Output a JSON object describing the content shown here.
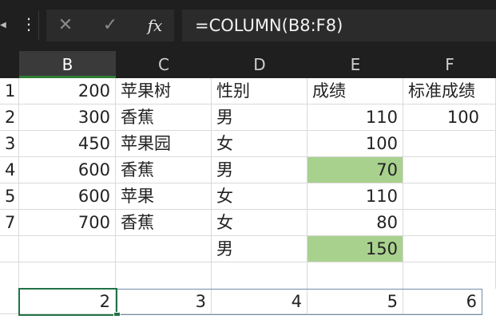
{
  "formula_bar": {
    "left_arrow": "◀",
    "menu_icon": "⋮",
    "cancel_icon": "✕",
    "confirm_icon": "✓",
    "fx_label": "fx",
    "formula": "=COLUMN(B8:F8)"
  },
  "columns": [
    "B",
    "C",
    "D",
    "E",
    "F"
  ],
  "rows": [
    {
      "rownum": "1",
      "b": "200",
      "c": "苹果树",
      "d": "性别",
      "e": "成绩",
      "f": "标准成绩"
    },
    {
      "rownum": "2",
      "b": "300",
      "c": "香蕉",
      "d": "男",
      "e": "110",
      "f": "100"
    },
    {
      "rownum": "3",
      "b": "450",
      "c": "苹果园",
      "d": "女",
      "e": "100",
      "f": ""
    },
    {
      "rownum": "4",
      "b": "600",
      "c": "香蕉",
      "d": "男",
      "e": "70",
      "f": ""
    },
    {
      "rownum": "5",
      "b": "600",
      "c": "苹果",
      "d": "女",
      "e": "110",
      "f": ""
    },
    {
      "rownum": "7",
      "b": "700",
      "c": "香蕉",
      "d": "女",
      "e": "80",
      "f": ""
    },
    {
      "rownum": "",
      "b": "",
      "c": "",
      "d": "男",
      "e": "150",
      "f": ""
    },
    {
      "rownum": "",
      "b": "",
      "c": "",
      "d": "",
      "e": "",
      "f": ""
    },
    {
      "rownum": "",
      "b": "2",
      "c": "3",
      "d": "4",
      "e": "5",
      "f": "6"
    }
  ],
  "colors": {
    "highlight_green": "#a9d18e",
    "selection_green": "#217346"
  }
}
